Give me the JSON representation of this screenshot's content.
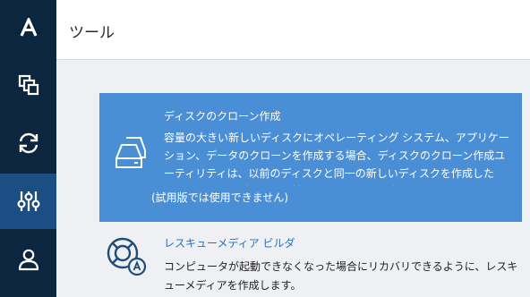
{
  "header": {
    "title": "ツール"
  },
  "sidebar": {
    "items": [
      {
        "icon": "acronis-logo-icon"
      },
      {
        "icon": "backup-copies-icon"
      },
      {
        "icon": "sync-icon"
      },
      {
        "icon": "tools-sliders-icon",
        "active": true
      },
      {
        "icon": "account-icon"
      }
    ]
  },
  "tools": {
    "clone": {
      "icon": "disk-clone-icon",
      "title": "ディスクのクローン作成",
      "description": "容量の大きい新しいディスクにオペレーティング システム、アプリケーション、データのクローンを作成する場合、ディスクのクローン作成ユーティリティは、以前のディスクと同一の新しいディスクを作成したり、システムとデータを維持したりするのに役立ちます。",
      "note": "(試用版では使用できません)"
    },
    "rescue": {
      "icon": "rescue-media-icon",
      "title": "レスキューメディア ビルダ",
      "description": "コンピュータが起動できなくなった場合にリカバリできるように、レスキューメディアを作成します。"
    }
  },
  "colors": {
    "sidebar": "#0d2640",
    "sidebar_active": "#1b4f84",
    "accent": "#4a8fd6",
    "link": "#2a6fbf"
  }
}
